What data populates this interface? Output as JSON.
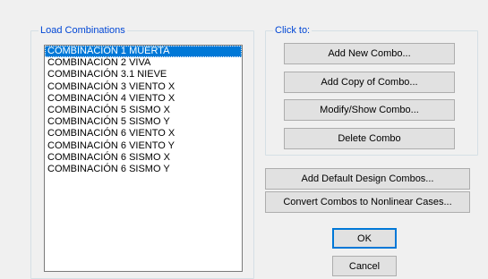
{
  "load_combinations": {
    "title": "Load Combinations",
    "items": [
      {
        "label": "COMBINACION 1 MUERTA",
        "selected": true
      },
      {
        "label": "COMBINACIÓN 2 VIVA",
        "selected": false
      },
      {
        "label": "COMBINACIÓN 3.1 NIEVE",
        "selected": false
      },
      {
        "label": "COMBINACIÓN 3 VIENTO X",
        "selected": false
      },
      {
        "label": "COMBINACIÓN 4 VIENTO X",
        "selected": false
      },
      {
        "label": "COMBINACIÓN 5 SISMO X",
        "selected": false
      },
      {
        "label": "COMBINACIÓN 5 SISMO Y",
        "selected": false
      },
      {
        "label": "COMBINACIÓN 6 VIENTO X",
        "selected": false
      },
      {
        "label": "COMBINACIÓN 6 VIENTO Y",
        "selected": false
      },
      {
        "label": "COMBINACIÓN 6 SISMO X",
        "selected": false
      },
      {
        "label": "COMBINACIÓN 6 SISMO Y",
        "selected": false
      }
    ]
  },
  "click_to": {
    "title": "Click to:",
    "add_new": "Add New Combo...",
    "add_copy": "Add Copy of Combo...",
    "modify_show": "Modify/Show Combo...",
    "delete": "Delete Combo"
  },
  "actions": {
    "add_default": "Add Default Design Combos...",
    "convert": "Convert Combos to Nonlinear Cases..."
  },
  "dialog": {
    "ok": "OK",
    "cancel": "Cancel"
  },
  "colors": {
    "selection": "#0078d7",
    "group_title": "#0046d5"
  }
}
